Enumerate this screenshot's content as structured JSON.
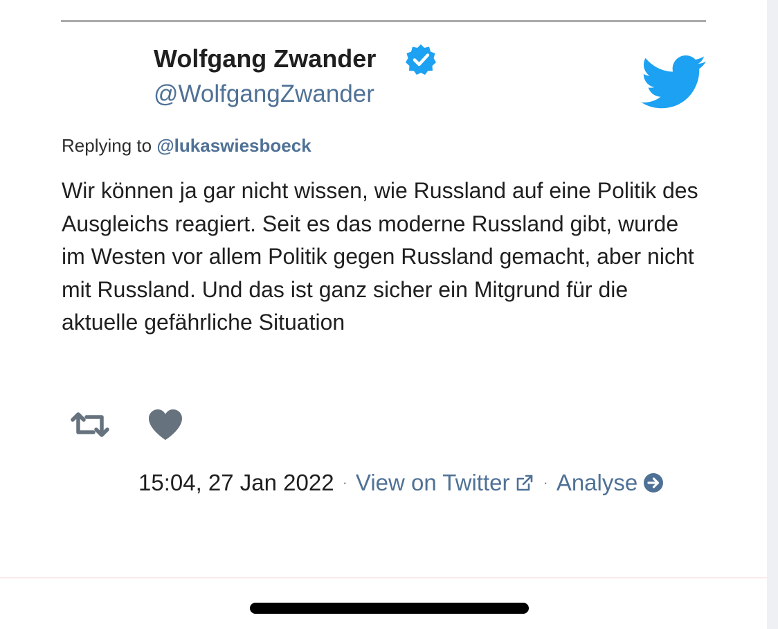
{
  "tweet": {
    "author_name": "Wolfgang Zwander",
    "author_handle": "@WolfgangZwander",
    "reply_prefix": "Replying to",
    "reply_to_handle": "@lukaswiesboeck",
    "text": "Wir können ja gar nicht wissen, wie Russland auf eine Politik des Ausgleichs reagiert. Seit es das moderne Russland gibt, wurde im Westen vor allem Politik gegen Russland gemacht, aber nicht mit Russland. Und das ist ganz sicher ein Mitgrund für die aktuelle gefährliche Situation",
    "timestamp": "15:04, 27 Jan 2022",
    "separator": "·",
    "view_link_label": "View on Twitter",
    "analyse_link_label": "Analyse"
  },
  "icons": {
    "verified": "verified-badge-icon",
    "logo": "twitter-bird-icon",
    "retweet": "retweet-icon",
    "like": "heart-icon",
    "external": "external-link-icon",
    "arrow": "arrow-circle-right-icon"
  },
  "colors": {
    "link_blue": "#4f7196",
    "twitter_blue": "#1da1f2",
    "icon_gray": "#66727d",
    "text": "#1f1f1f"
  }
}
